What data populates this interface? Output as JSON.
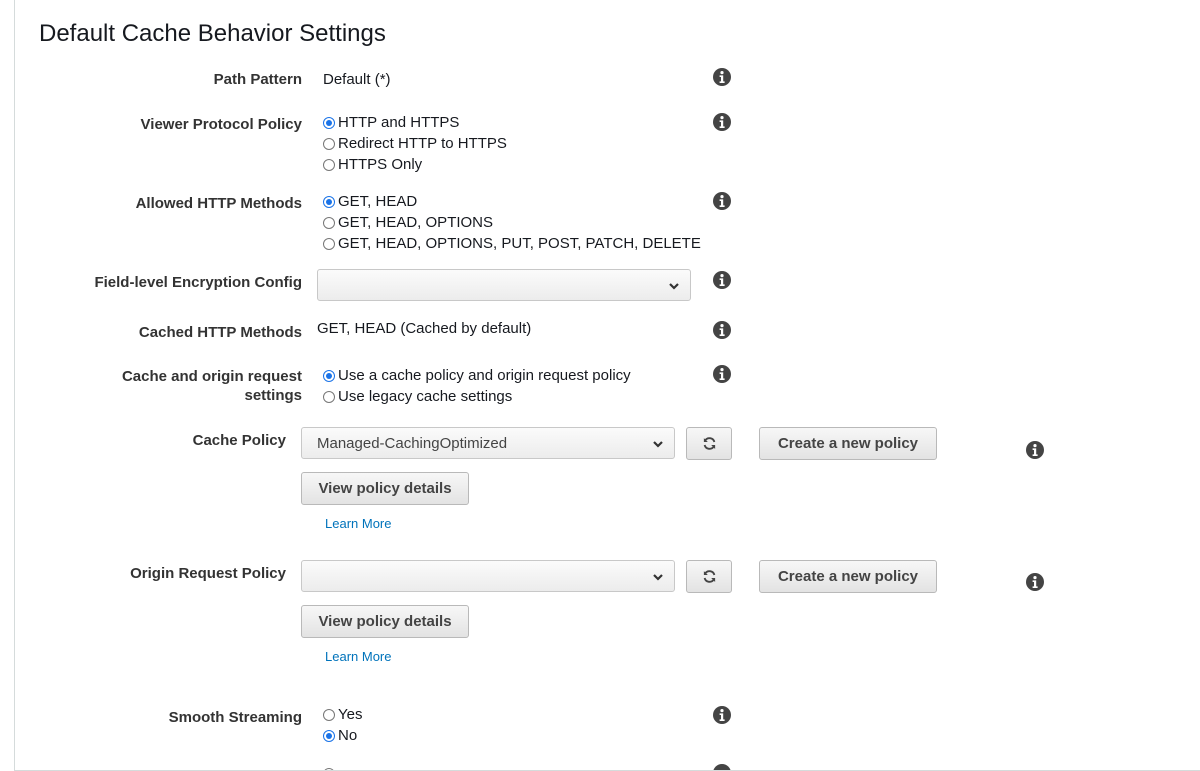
{
  "section": {
    "title": "Default Cache Behavior Settings"
  },
  "path_pattern": {
    "label": "Path Pattern",
    "value": "Default (*)"
  },
  "viewer_protocol": {
    "label": "Viewer Protocol Policy",
    "options": [
      {
        "label": "HTTP and HTTPS",
        "checked": true
      },
      {
        "label": "Redirect HTTP to HTTPS",
        "checked": false
      },
      {
        "label": "HTTPS Only",
        "checked": false
      }
    ]
  },
  "allowed_methods": {
    "label": "Allowed HTTP Methods",
    "options": [
      {
        "label": "GET, HEAD",
        "checked": true
      },
      {
        "label": "GET, HEAD, OPTIONS",
        "checked": false
      },
      {
        "label": "GET, HEAD, OPTIONS, PUT, POST, PATCH, DELETE",
        "checked": false
      }
    ]
  },
  "field_encryption": {
    "label": "Field-level Encryption Config",
    "value": ""
  },
  "cached_methods": {
    "label": "Cached HTTP Methods",
    "value": "GET, HEAD (Cached by default)"
  },
  "cache_origin_settings": {
    "label_line1": "Cache and origin request",
    "label_line2": "settings",
    "options": [
      {
        "label": "Use a cache policy and origin request policy",
        "checked": true
      },
      {
        "label": "Use legacy cache settings",
        "checked": false
      }
    ]
  },
  "cache_policy": {
    "label": "Cache Policy",
    "selected": "Managed-CachingOptimized",
    "create_label": "Create a new policy",
    "details_label": "View policy details",
    "learn_more": "Learn More"
  },
  "origin_request_policy": {
    "label": "Origin Request Policy",
    "selected": "",
    "create_label": "Create a new policy",
    "details_label": "View policy details",
    "learn_more": "Learn More"
  },
  "smooth_streaming": {
    "label": "Smooth Streaming",
    "options": [
      {
        "label": "Yes",
        "checked": false
      },
      {
        "label": "No",
        "checked": true
      }
    ]
  },
  "icons": {
    "info": "info-icon",
    "refresh": "refresh-icon",
    "chevron": "chevron-down-icon"
  },
  "colors": {
    "radio_selected": "#1a73e8",
    "link": "#0073bb",
    "icon": "#444444"
  }
}
